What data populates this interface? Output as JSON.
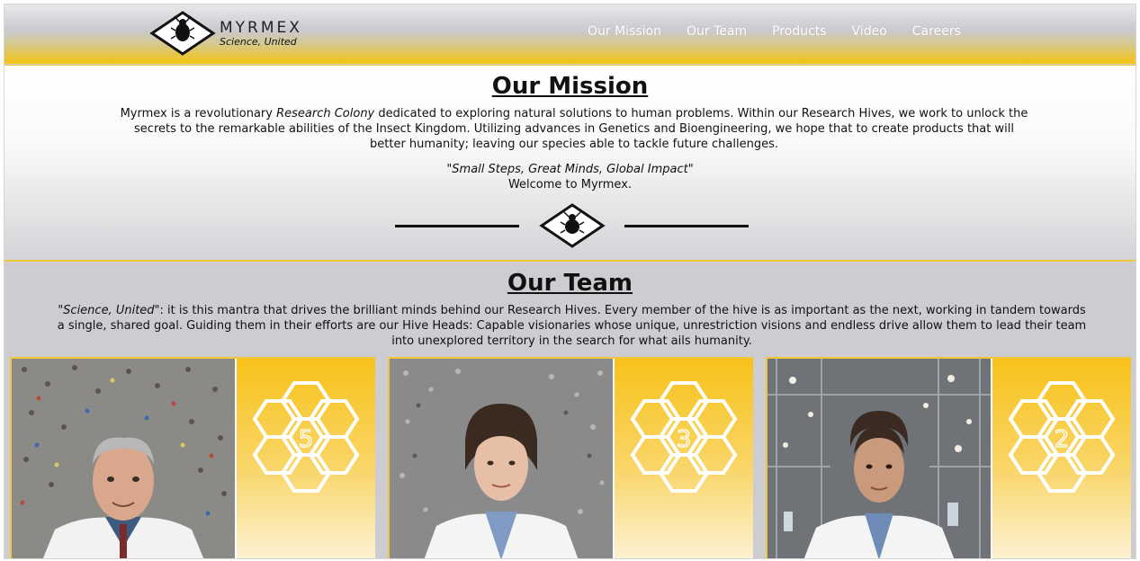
{
  "brand": {
    "name": "MYRMEX",
    "name_suffix": "",
    "tagline": "Science, United"
  },
  "nav": {
    "items": [
      {
        "label": "Our Mission"
      },
      {
        "label": "Our Team"
      },
      {
        "label": "Products"
      },
      {
        "label": "Video"
      },
      {
        "label": "Careers"
      }
    ]
  },
  "mission": {
    "title": "Our Mission",
    "text_pre": "Myrmex is a revolutionary ",
    "text_em": "Research Colony",
    "text_post": " dedicated to exploring natural solutions to human problems. Within our Research Hives, we work to unlock the secrets to the remarkable abilities of the Insect Kingdom. Utilizing advances in Genetics and Bioengineering, we hope that to create products that will better humanity; leaving our species able to tackle future challenges.",
    "quote": "\"Small Steps, Great Minds, Global Impact\"",
    "welcome": "Welcome to Myrmex."
  },
  "team": {
    "title": "Our Team",
    "text_em": "\"Science, United\"",
    "text_post": ": it is this mantra that drives the brilliant minds behind our Research Hives. Every member of the hive is as important as the next, working in tandem towards a single, shared goal. Guiding them in their efforts are our Hive Heads: Capable visionaries whose unique, unrestriction visions and endless drive allow them to lead their team into unexplored territory in the search for what ails humanity.",
    "members": [
      {
        "hive_number": "5",
        "photo": "older-man-scientist-portrait"
      },
      {
        "hive_number": "3",
        "photo": "woman-scientist-portrait"
      },
      {
        "hive_number": "2",
        "photo": "woman-scientist-lab-portrait"
      }
    ]
  },
  "colors": {
    "accent": "#f4c61c",
    "nav_text": "#ffffff",
    "text": "#111111"
  }
}
